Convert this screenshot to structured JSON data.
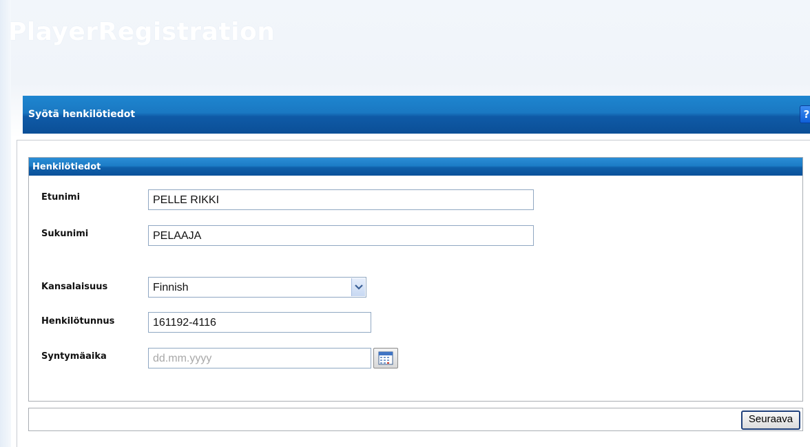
{
  "app": {
    "title": "PlayerRegistration"
  },
  "header": {
    "title": "Syötä henkilötiedot",
    "help_label": "?"
  },
  "section": {
    "title": "Henkilötiedot"
  },
  "fields": {
    "first_name": {
      "label": "Etunimi",
      "value": "PELLE RIKKI"
    },
    "last_name": {
      "label": "Sukunimi",
      "value": "PELAAJA"
    },
    "nationality": {
      "label": "Kansalaisuus",
      "value": "Finnish"
    },
    "personal_id": {
      "label": "Henkilötunnus",
      "value": "161192-4116"
    },
    "birth_date": {
      "label": "Syntymäaika",
      "value": "",
      "placeholder": "dd.mm.yyyy"
    }
  },
  "footer": {
    "next_label": "Seuraava"
  },
  "icons": {
    "help": "help-icon",
    "dropdown": "chevron-down-icon",
    "calendar": "calendar-icon"
  },
  "colors": {
    "header_blue": "#1a78c2",
    "section_blue": "#1c7cc6",
    "input_border": "#8fa7c2"
  }
}
